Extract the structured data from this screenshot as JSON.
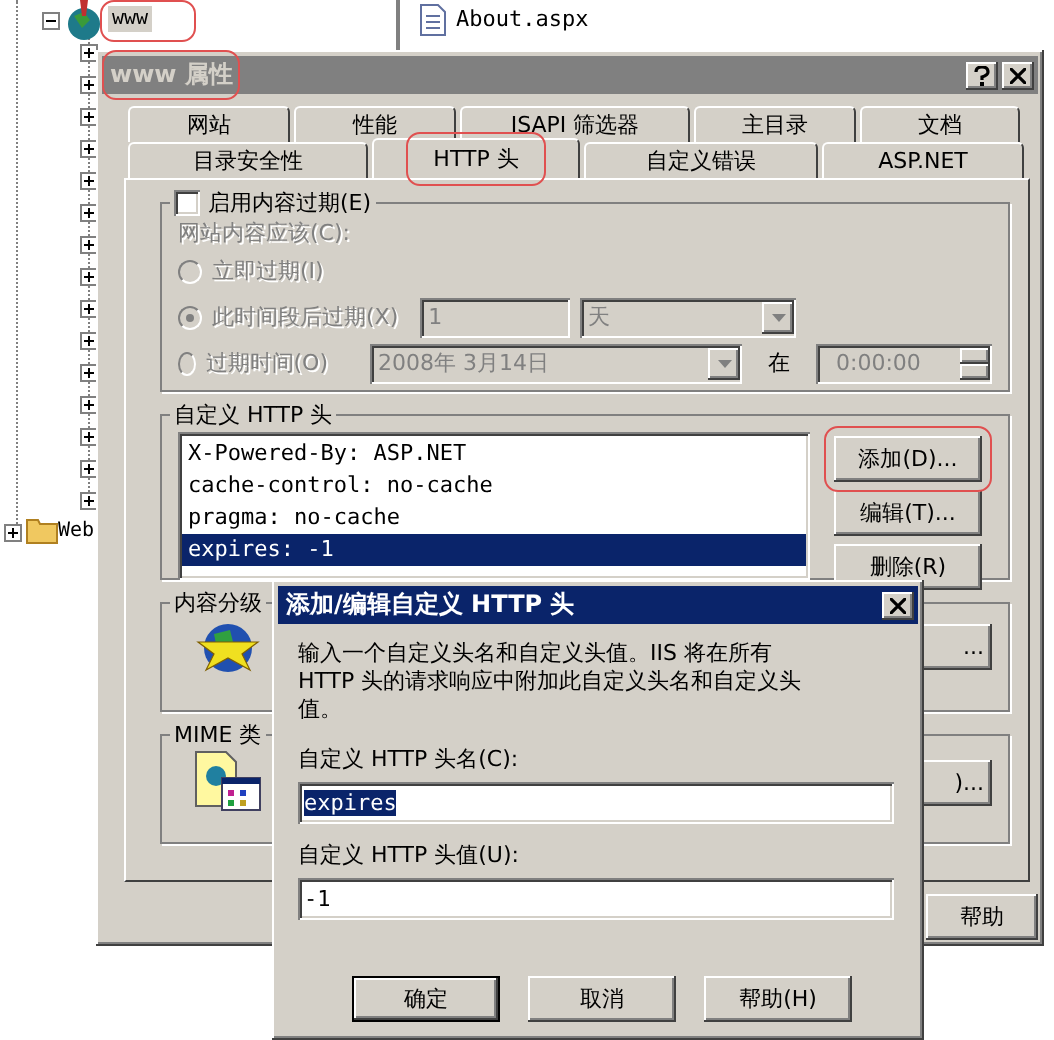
{
  "tree": {
    "items": [
      {
        "label": "www",
        "expanded": true,
        "highlighted": true,
        "children": [
          {
            "expanded": false
          },
          {
            "expanded": false
          },
          {
            "expanded": false
          },
          {
            "expanded": false
          },
          {
            "expanded": false
          },
          {
            "expanded": false
          },
          {
            "expanded": false
          },
          {
            "expanded": false
          },
          {
            "expanded": false
          },
          {
            "expanded": false
          },
          {
            "expanded": false
          },
          {
            "expanded": false
          },
          {
            "expanded": false
          },
          {
            "expanded": false
          },
          {
            "expanded": false
          }
        ]
      },
      {
        "label": "Web",
        "expanded": false
      }
    ]
  },
  "files": [
    "About.aspx"
  ],
  "properties_window": {
    "title": "www 属性",
    "active": false,
    "title_highlighted": true,
    "tab_rows": [
      [
        {
          "label": "网站",
          "selected": false,
          "highlighted": false
        },
        {
          "label": "性能",
          "selected": false,
          "highlighted": false
        },
        {
          "label": "ISAPI 筛选器",
          "selected": false,
          "highlighted": false
        },
        {
          "label": "主目录",
          "selected": false,
          "highlighted": false
        },
        {
          "label": "文档",
          "selected": false,
          "highlighted": false
        }
      ],
      [
        {
          "label": "目录安全性",
          "selected": false,
          "highlighted": false
        },
        {
          "label": "HTTP 头",
          "selected": true,
          "highlighted": true
        },
        {
          "label": "自定义错误",
          "selected": false,
          "highlighted": false
        },
        {
          "label": "ASP.NET",
          "selected": false,
          "highlighted": false
        }
      ]
    ],
    "content_expiration": {
      "label": "启用内容过期(E)",
      "checked": false,
      "prompt": "网站内容应该(C):",
      "options": [
        {
          "kind": "plain",
          "label": "立即过期(I)",
          "selected": false,
          "disabled": true
        },
        {
          "kind": "duration",
          "label": "此时间段后过期(X)",
          "selected": true,
          "disabled": true,
          "amount": "1",
          "unit": "天"
        },
        {
          "kind": "date",
          "label": "过期时间(O)",
          "selected": false,
          "disabled": true,
          "date": "2008年 3月14日",
          "at": "在",
          "time": "0:00:00"
        }
      ]
    },
    "custom_headers": {
      "label": "自定义 HTTP 头",
      "items": [
        {
          "text": "X-Powered-By: ASP.NET",
          "selected": false
        },
        {
          "text": "cache-control: no-cache",
          "selected": false
        },
        {
          "text": "pragma: no-cache",
          "selected": false
        },
        {
          "text": "expires: -1",
          "selected": true
        }
      ],
      "buttons": [
        {
          "label": "添加(D)...",
          "highlighted": true
        },
        {
          "label": "编辑(T)...",
          "highlighted": false
        },
        {
          "label": "删除(R)",
          "highlighted": false
        }
      ]
    },
    "content_rating": {
      "label": "内容分级",
      "button": "..."
    },
    "mime_types": {
      "label": "MIME 类",
      "button": ")..."
    },
    "help_button": "帮助"
  },
  "dialog": {
    "title": "添加/编辑自定义 HTTP 头",
    "active": true,
    "description": "输入一个自定义头名和自定义头值。IIS 将在所有 HTTP 头的请求响应中附加此自定义头名和自定义头值。",
    "name_label": "自定义 HTTP 头名(C):",
    "name_value": "expires",
    "name_selected": true,
    "value_label": "自定义 HTTP 头值(U):",
    "value_value": "-1",
    "buttons": [
      {
        "label": "确定",
        "default": true
      },
      {
        "label": "取消",
        "default": false
      },
      {
        "label": "帮助(H)",
        "default": false
      }
    ]
  }
}
